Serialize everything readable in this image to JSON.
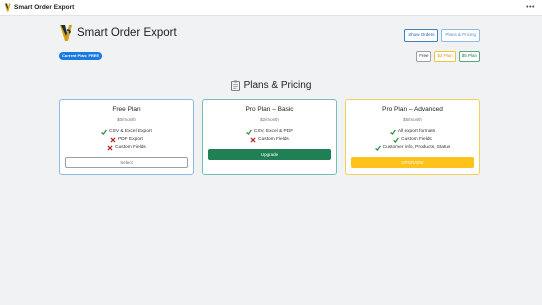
{
  "app": {
    "title": "Smart Order Export",
    "menu_icon": "more-horizontal-icon"
  },
  "header": {
    "title": "Smart Order Export",
    "buttons": {
      "show_orders": "Show Orders",
      "plans_pricing": "Plans & Pricing"
    }
  },
  "current_plan": {
    "label": "Current Plan: FREE"
  },
  "plan_selector": {
    "free": "Free",
    "basic": "$2 Plan",
    "advanced": "$5 Plan"
  },
  "section": {
    "title": "Plans & Pricing",
    "icon": "clipboard-icon"
  },
  "plans": [
    {
      "name": "Free Plan",
      "price": "$0/month",
      "features": [
        {
          "text": "CSV & Excel Export",
          "included": true
        },
        {
          "text": "PDF Export",
          "included": false
        },
        {
          "text": "Custom Fields",
          "included": false
        }
      ],
      "cta": "Select"
    },
    {
      "name": "Pro Plan – Basic",
      "price": "$2/month",
      "features": [
        {
          "text": "CSV, Excel & PDF",
          "included": true
        },
        {
          "text": "Custom Fields",
          "included": false
        }
      ],
      "cta": "Upgrade"
    },
    {
      "name": "Pro Plan – Advanced",
      "price": "$5/month",
      "features": [
        {
          "text": "All export formats",
          "included": true
        },
        {
          "text": "Custom Fields",
          "included": true
        },
        {
          "text": "Customer info, Products, Status",
          "included": true
        }
      ],
      "cta": "UPGRADE"
    }
  ],
  "colors": {
    "check": "#2e8b3a",
    "cross": "#b3261e",
    "upgrade_green": "#1f7f55",
    "upgrade_gold": "#ffc21a",
    "badge_blue": "#1a7ae0"
  }
}
